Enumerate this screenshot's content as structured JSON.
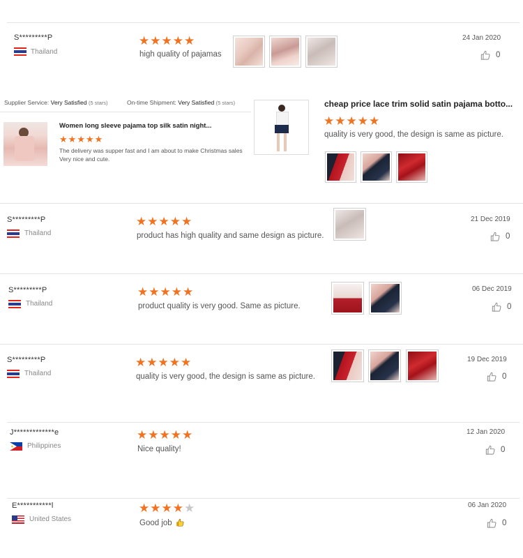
{
  "reviews": [
    {
      "user": "S*********P",
      "country": "Thailand",
      "flag": "thailand",
      "rating": 5,
      "text": "high quality of pajamas",
      "date": "24 Jan 2020",
      "likes": "0"
    },
    {
      "user": "S*********P",
      "country": "Thailand",
      "flag": "thailand",
      "rating": 5,
      "text": "product has high quality and same design as picture.",
      "date": "21 Dec 2019",
      "likes": "0"
    },
    {
      "user": "S*********P",
      "country": "Thailand",
      "flag": "thailand",
      "rating": 5,
      "text": "product quality is very good. Same as picture.",
      "date": "06 Dec 2019",
      "likes": "0"
    },
    {
      "user": "S*********P",
      "country": "Thailand",
      "flag": "thailand",
      "rating": 5,
      "text": "quality is very good, the design is same as picture.",
      "date": "19 Dec 2019",
      "likes": "0"
    },
    {
      "user": "J*************e",
      "country": "Philippines",
      "flag": "philippines",
      "rating": 5,
      "text": "Nice quality!",
      "date": "12 Jan 2020",
      "likes": "0"
    },
    {
      "user": "E***********l",
      "country": "United States",
      "flag": "united-states",
      "rating": 4,
      "text": "Good job",
      "date": "06 Jan 2020",
      "likes": "0"
    }
  ],
  "supplier": {
    "service_label": "Supplier Service:",
    "service_value": "Very Satisfied",
    "service_stars": "(5 stars)",
    "shipment_label": "On-time Shipment:",
    "shipment_value": "Very Satisfied",
    "shipment_stars": "(5 stars)"
  },
  "product_left": {
    "title": "Women long sleeve pajama top silk satin night...",
    "rating": 5,
    "line1": "The delivery was supper fast and I am about to make Christmas sales",
    "line2": "Very nice and cute."
  },
  "product_right": {
    "title": "cheap price lace trim solid satin pajama botto...",
    "rating": 5,
    "text": "quality is very good, the design is same as picture."
  },
  "colors": {
    "star": "#f07322",
    "star_off": "#c8c8c8",
    "divider": "#e3e3e3"
  }
}
